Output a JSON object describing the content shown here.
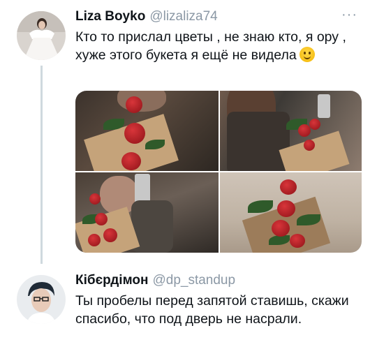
{
  "tweets": [
    {
      "name": "Liza Boyko",
      "handle": "@lizaliza74",
      "more": "···",
      "text": "Кто то прислал цветы , не знаю кто, я ору , хуже этого букета я ещё не видела",
      "emoji": "slightly-smiling-face-icon"
    },
    {
      "name": "Кібєрдімон",
      "handle": "@dp_standup",
      "text": "Ты пробелы перед запятой ставишь, скажи спасибо, что под дверь не насрали."
    }
  ],
  "colors": {
    "text": "#0f1419",
    "secondary": "#8b98a5",
    "thread_line": "#cfd9de",
    "background": "#ffffff"
  }
}
